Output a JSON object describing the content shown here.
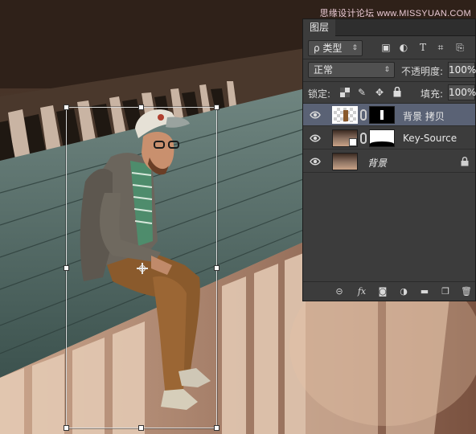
{
  "watermark": "思缘设计论坛 www.MISSYUAN.COM",
  "panel": {
    "tab_label": "图层",
    "filter": {
      "label": "ρ 类型"
    },
    "filter_icons": [
      "image-filter-icon",
      "adjustment-filter-icon",
      "type-filter-icon",
      "shape-filter-icon",
      "smart-object-filter-icon"
    ],
    "blend_mode": "正常",
    "opacity_label": "不透明度:",
    "opacity_value": "100%",
    "lock_label": "锁定:",
    "fill_label": "填充:",
    "fill_value": "100%",
    "layers": [
      {
        "name": "背景 拷贝",
        "visible": true,
        "selected": true,
        "has_mask": true
      },
      {
        "name": "Key-Source",
        "visible": true,
        "selected": false,
        "has_mask": true
      },
      {
        "name": "背景",
        "visible": true,
        "selected": false,
        "locked": true
      }
    ],
    "footer_icons": [
      "link-layers-icon",
      "fx-icon",
      "add-mask-icon",
      "adjustment-layer-icon",
      "new-group-icon",
      "new-layer-icon",
      "delete-layer-icon"
    ],
    "fx_label": "fx"
  },
  "colors": {
    "panel_bg": "#3c3c3c",
    "selected_layer": "#5a6275",
    "watermark": "#e9c9d4"
  }
}
